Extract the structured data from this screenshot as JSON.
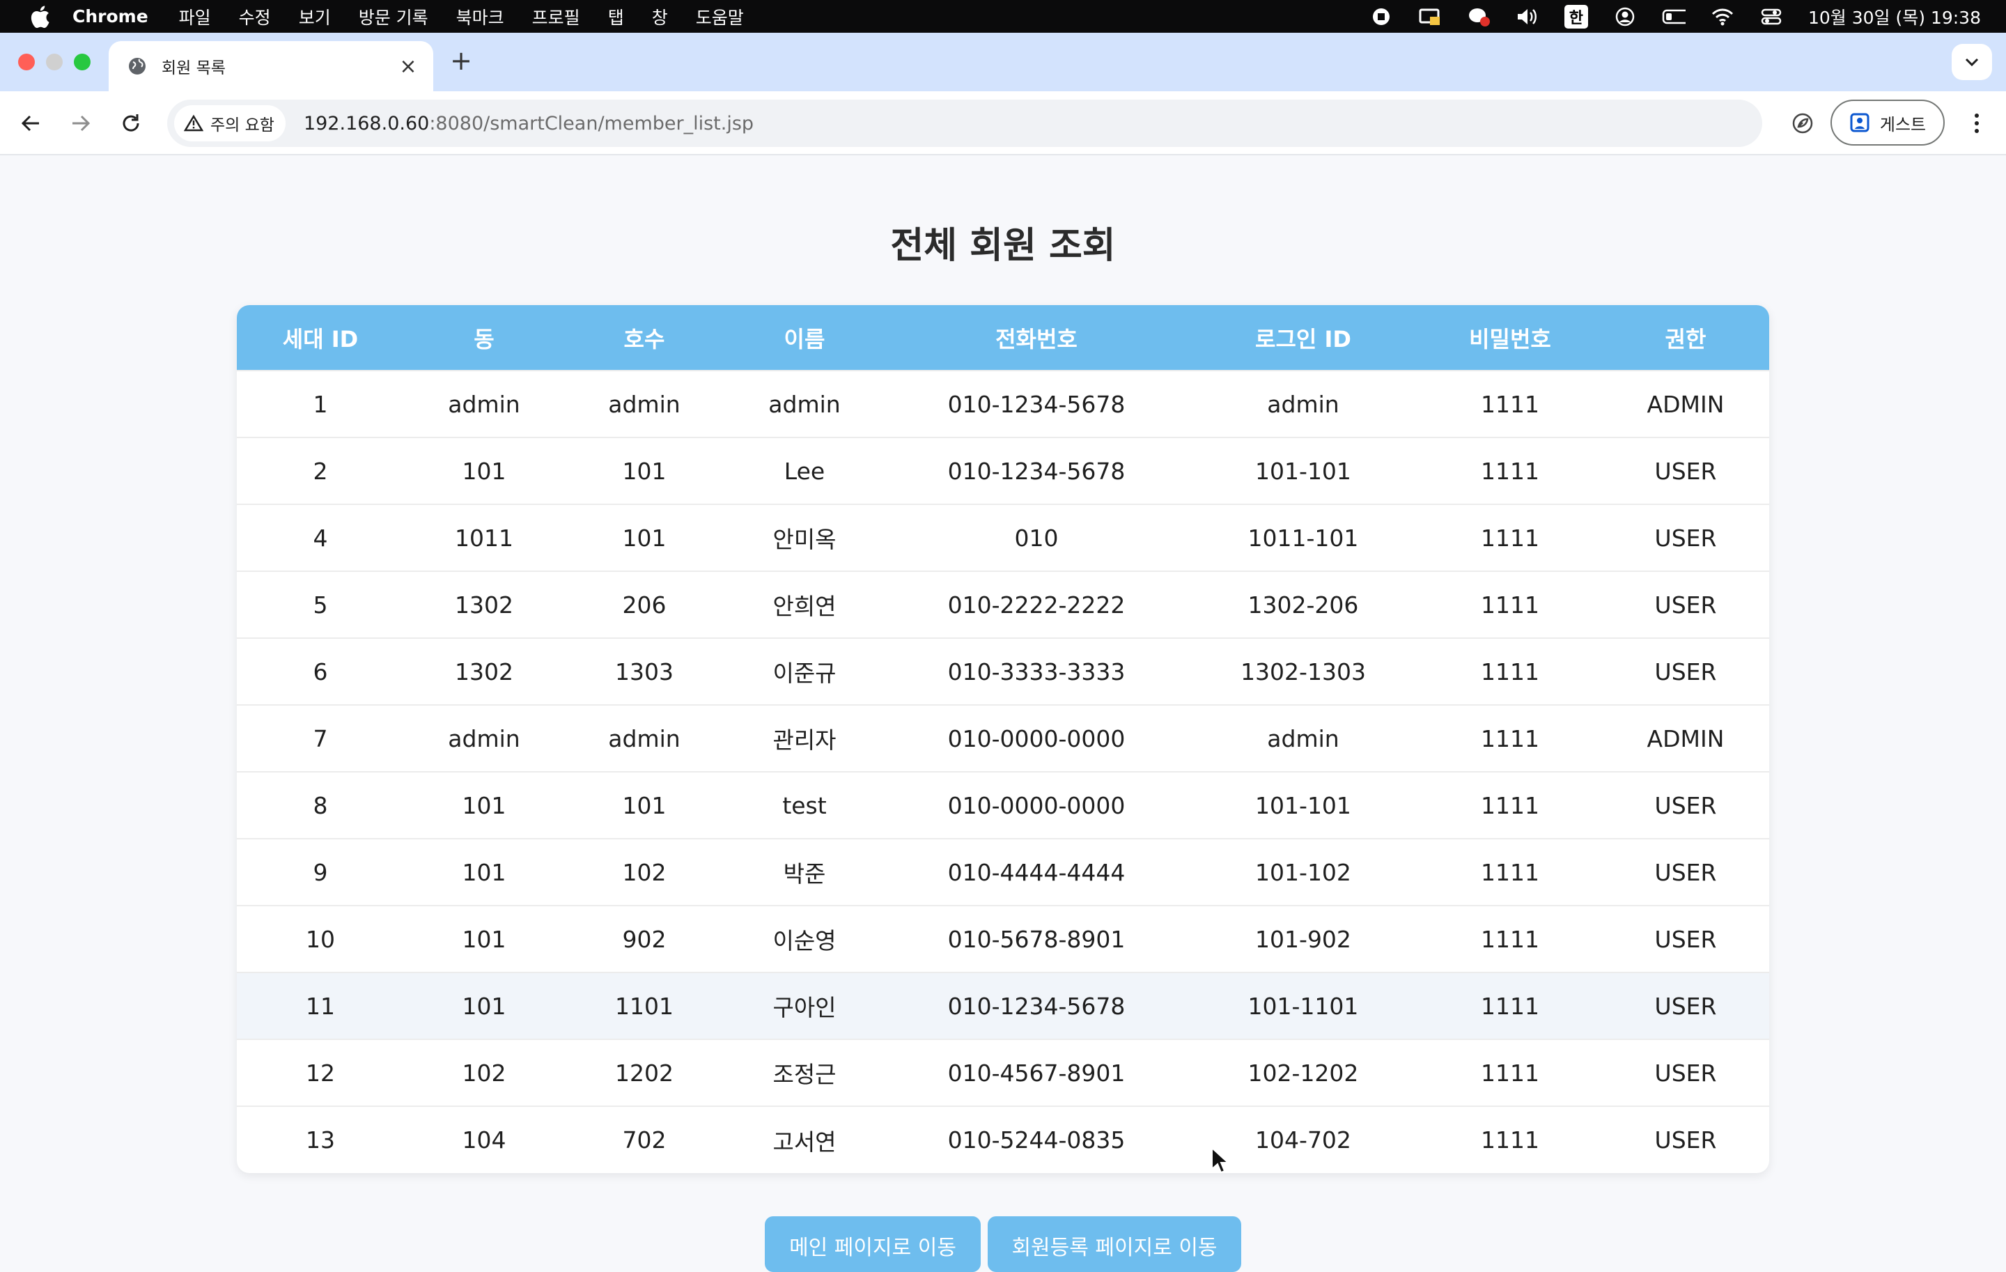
{
  "menubar": {
    "app_name": "Chrome",
    "items": [
      "파일",
      "수정",
      "보기",
      "방문 기록",
      "북마크",
      "프로필",
      "탭",
      "창",
      "도움말"
    ],
    "input_method": "한",
    "clock": "10월 30일 (목) 19:38"
  },
  "browser": {
    "tab_title": "회원 목록",
    "security_label": "주의 요함",
    "url_host": "192.168.0.60",
    "url_rest": ":8080/smartClean/member_list.jsp",
    "profile_label": "게스트"
  },
  "page": {
    "title": "전체 회원 조회",
    "columns": [
      "세대 ID",
      "동",
      "호수",
      "이름",
      "전화번호",
      "로그인 ID",
      "비밀번호",
      "권한"
    ],
    "rows": [
      [
        "1",
        "admin",
        "admin",
        "admin",
        "010-1234-5678",
        "admin",
        "1111",
        "ADMIN"
      ],
      [
        "2",
        "101",
        "101",
        "Lee",
        "010-1234-5678",
        "101-101",
        "1111",
        "USER"
      ],
      [
        "4",
        "1011",
        "101",
        "안미옥",
        "010",
        "1011-101",
        "1111",
        "USER"
      ],
      [
        "5",
        "1302",
        "206",
        "안희연",
        "010-2222-2222",
        "1302-206",
        "1111",
        "USER"
      ],
      [
        "6",
        "1302",
        "1303",
        "이준규",
        "010-3333-3333",
        "1302-1303",
        "1111",
        "USER"
      ],
      [
        "7",
        "admin",
        "admin",
        "관리자",
        "010-0000-0000",
        "admin",
        "1111",
        "ADMIN"
      ],
      [
        "8",
        "101",
        "101",
        "test",
        "010-0000-0000",
        "101-101",
        "1111",
        "USER"
      ],
      [
        "9",
        "101",
        "102",
        "박준",
        "010-4444-4444",
        "101-102",
        "1111",
        "USER"
      ],
      [
        "10",
        "101",
        "902",
        "이순영",
        "010-5678-8901",
        "101-902",
        "1111",
        "USER"
      ],
      [
        "11",
        "101",
        "1101",
        "구아인",
        "010-1234-5678",
        "101-1101",
        "1111",
        "USER"
      ],
      [
        "12",
        "102",
        "1202",
        "조정근",
        "010-4567-8901",
        "102-1202",
        "1111",
        "USER"
      ],
      [
        "13",
        "104",
        "702",
        "고서연",
        "010-5244-0835",
        "104-702",
        "1111",
        "USER"
      ]
    ],
    "hovered_row": 9,
    "buttons": {
      "main": "메인 페이지로 이동",
      "register": "회원등록 페이지로 이동"
    }
  },
  "colors": {
    "accent": "#6ebdee",
    "tabstrip": "#d3e3fd"
  }
}
